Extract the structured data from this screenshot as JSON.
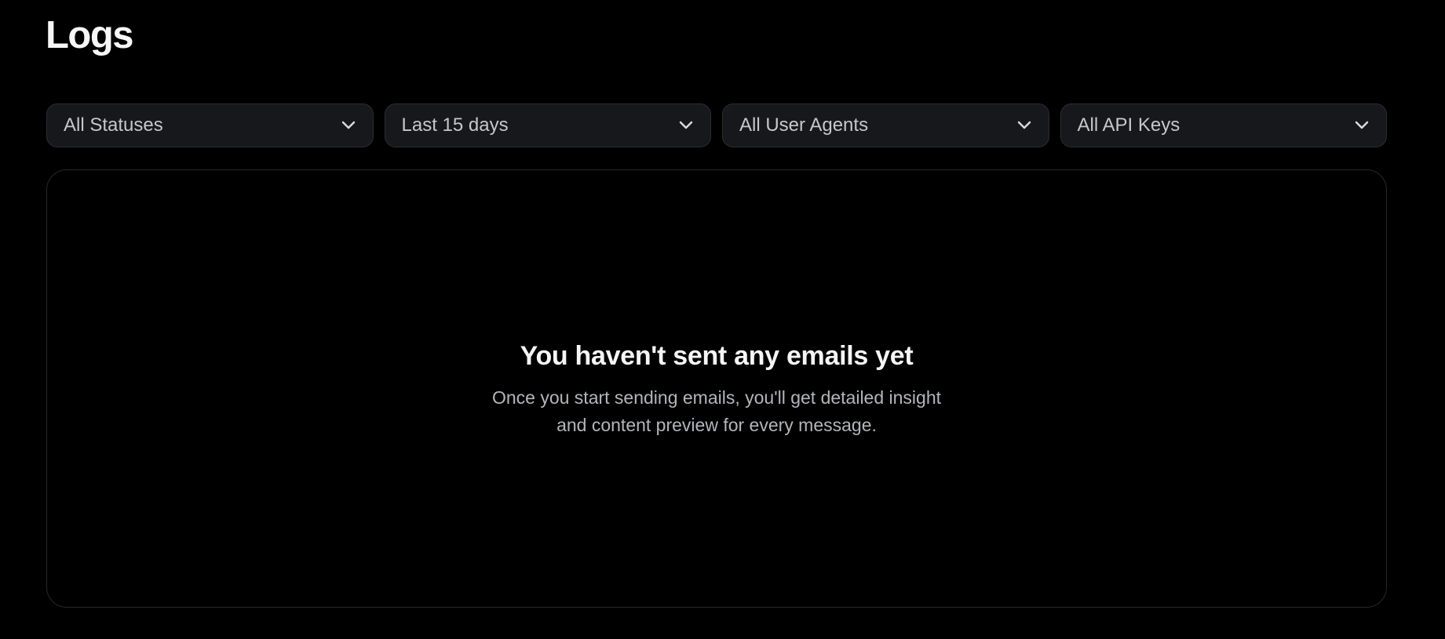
{
  "page": {
    "title": "Logs"
  },
  "filters": [
    {
      "selected": "All Statuses",
      "icon": "chevron-down-icon"
    },
    {
      "selected": "Last 15 days",
      "icon": "chevron-down-icon"
    },
    {
      "selected": "All User Agents",
      "icon": "chevron-down-icon"
    },
    {
      "selected": "All API Keys",
      "icon": "chevron-down-icon"
    }
  ],
  "empty_state": {
    "title": "You haven't sent any emails yet",
    "description": "Once you start sending emails, you'll get detailed insight and content preview for every message."
  },
  "colors": {
    "background": "#000000",
    "select_background": "#17181b",
    "select_border": "#2c2e32",
    "panel_border": "#26272b",
    "primary_text": "#f5f5f5",
    "secondary_text": "#b3b5ba"
  }
}
